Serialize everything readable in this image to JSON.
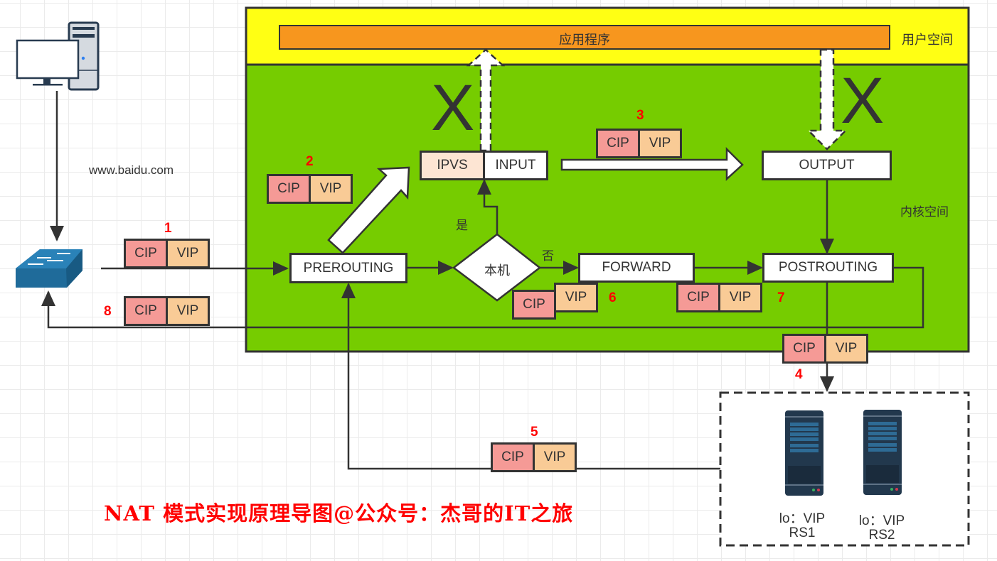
{
  "title": "NAT 模式实现原理导图@公众号：杰哥的IT之旅",
  "client": {
    "url_label": "www.baidu.com"
  },
  "zones": {
    "user_space": "用户空间",
    "kernel_space": "内核空间",
    "application": "应用程序"
  },
  "nodes": {
    "prerouting": "PREROUTING",
    "decision": "本机",
    "decision_yes": "是",
    "decision_no": "否",
    "ipvs": "IPVS",
    "input": "INPUT",
    "output": "OUTPUT",
    "forward": "FORWARD",
    "postrouting": "POSTROUTING"
  },
  "blocked_marks": {
    "to_app": "X",
    "from_app": "X"
  },
  "packets": [
    {
      "step": "1",
      "src": "CIP",
      "dst": "VIP"
    },
    {
      "step": "2",
      "src": "CIP",
      "dst": "VIP"
    },
    {
      "step": "3",
      "src": "CIP",
      "dst": "VIP"
    },
    {
      "step": "4",
      "src": "CIP",
      "dst": "VIP"
    },
    {
      "step": "5",
      "src": "CIP",
      "dst": "VIP"
    },
    {
      "step": "6",
      "src": "CIP",
      "dst": "VIP"
    },
    {
      "step": "7",
      "src": "CIP",
      "dst": "VIP"
    },
    {
      "step": "8",
      "src": "CIP",
      "dst": "VIP"
    }
  ],
  "real_servers": [
    {
      "lo": "lo：VIP",
      "name": "RS1"
    },
    {
      "lo": "lo：VIP",
      "name": "RS2"
    }
  ],
  "colors": {
    "user_space": "#ffff14",
    "kernel_space": "#76cc00",
    "application": "#f7961e",
    "cip": "#f59a96",
    "vip": "#f9cb96",
    "ipvs": "#fde5d3",
    "step_number": "#ff0000",
    "switch": "#1f6b9a"
  }
}
